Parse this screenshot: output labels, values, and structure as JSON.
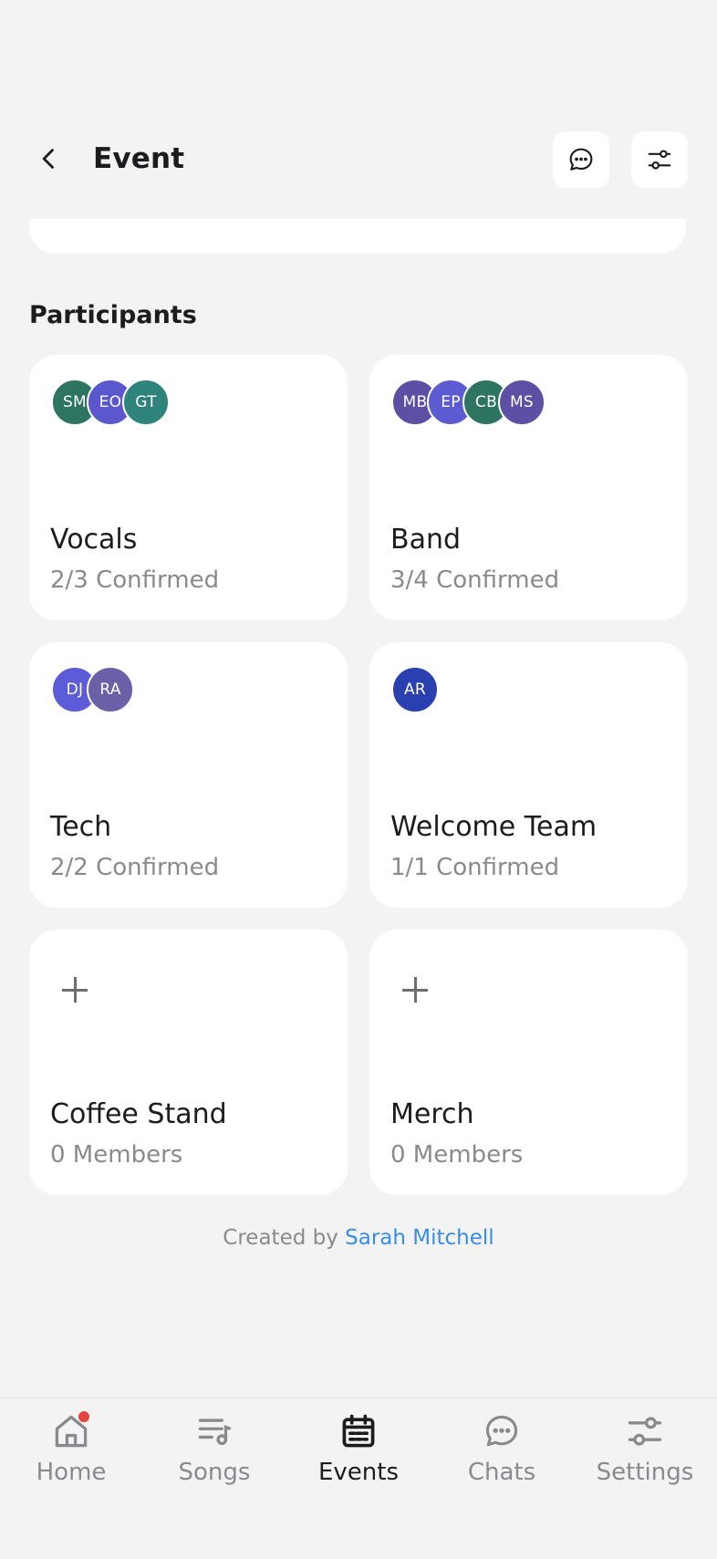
{
  "header": {
    "title": "Event"
  },
  "participants": {
    "section_title": "Participants",
    "teams": [
      {
        "name": "Vocals",
        "status": "2/3 Confirmed",
        "avatars": [
          {
            "initials": "SM",
            "color": "#2e7462"
          },
          {
            "initials": "EO",
            "color": "#5a58cc"
          },
          {
            "initials": "GT",
            "color": "#2e847c"
          }
        ]
      },
      {
        "name": "Band",
        "status": "3/4 Confirmed",
        "avatars": [
          {
            "initials": "MB",
            "color": "#5c4fa4"
          },
          {
            "initials": "EP",
            "color": "#5c5bd2"
          },
          {
            "initials": "CB",
            "color": "#2e7462"
          },
          {
            "initials": "MS",
            "color": "#5c4fa4"
          }
        ]
      },
      {
        "name": "Tech",
        "status": "2/2 Confirmed",
        "avatars": [
          {
            "initials": "DJ",
            "color": "#5c5bd8"
          },
          {
            "initials": "RA",
            "color": "#6a60a8"
          }
        ]
      },
      {
        "name": "Welcome Team",
        "status": "1/1 Confirmed",
        "avatars": [
          {
            "initials": "AR",
            "color": "#2a40b0"
          }
        ]
      },
      {
        "name": "Coffee Stand",
        "status": "0 Members",
        "avatars": []
      },
      {
        "name": "Merch",
        "status": "0 Members",
        "avatars": []
      }
    ]
  },
  "footer": {
    "created_by_prefix": "Created by",
    "creator_name": "Sarah Mitchell"
  },
  "tabbar": {
    "tabs": [
      {
        "label": "Home",
        "icon": "home-icon"
      },
      {
        "label": "Songs",
        "icon": "playlist-icon"
      },
      {
        "label": "Events",
        "icon": "calendar-icon",
        "active": true
      },
      {
        "label": "Chats",
        "icon": "chat-icon"
      },
      {
        "label": "Settings",
        "icon": "sliders-icon"
      }
    ]
  },
  "colors": {
    "link": "#3a8de0",
    "notification_dot": "#e0463d",
    "background": "#f3f3f3"
  }
}
